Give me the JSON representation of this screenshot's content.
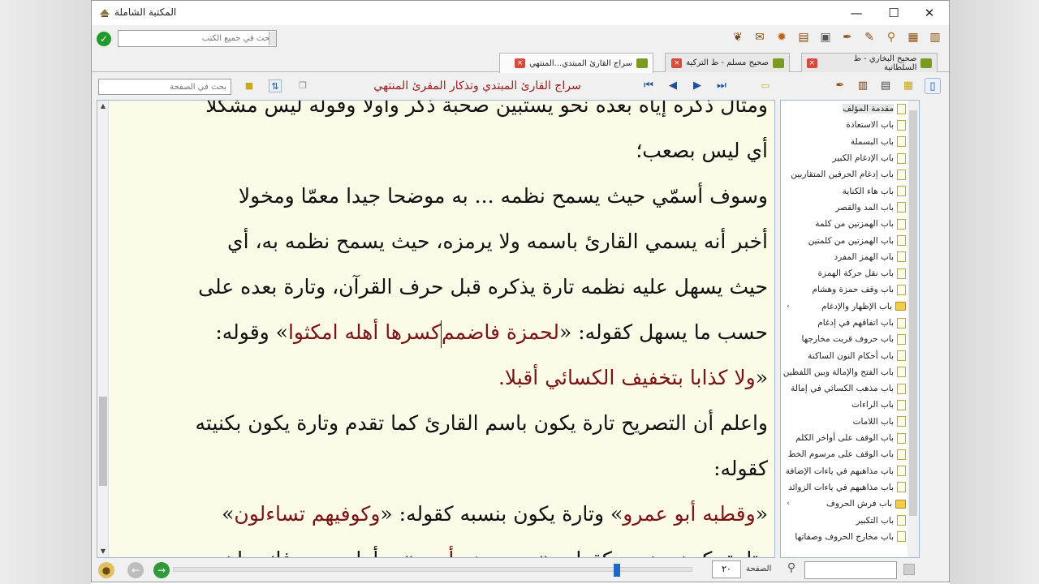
{
  "window": {
    "title": "المكتبة الشاملة",
    "controls": [
      "—",
      "☐",
      "✕"
    ]
  },
  "toolbar": {
    "global_search_placeholder": "بحث في جميع الكتب",
    "icons": [
      "book-icon",
      "bookshelf-icon",
      "search-icon",
      "edit-icon",
      "feather-icon",
      "save-icon",
      "layout-icon",
      "settings-icon",
      "mail-icon",
      "leaf-icon"
    ]
  },
  "tabs": [
    {
      "label": "صحيح البخاري - ط السلطانية",
      "active": false
    },
    {
      "label": "صحيح مسلم - ط التركية",
      "active": false
    },
    {
      "label": "سراج القارئ المبتدي...المنتهي",
      "active": true
    }
  ],
  "nav": {
    "page_search_placeholder": "بحث في الصفحة",
    "book_title": "سراج القارئ المبتدي وتذكار المقرئ المنتهي",
    "first": "⏮",
    "prev": "◀",
    "next": "▶",
    "last": "⏭"
  },
  "content": {
    "lines": [
      "ومثال ذكره إياه بعده نحو يستبين صحبة ذكر وأولا وقوله ليس مشكلا",
      "أي ليس بصعب؛",
      "وسوف أسمّي حيث يسمح نظمه ... به موضحا جيدا معمّا ومخولا",
      "أخبر أنه يسمي القارئ باسمه ولا يرمزه، حيث يسمح نظمه به، أي",
      "حيث يسهل عليه نظمه تارة يذكره قبل حرف القرآن، وتارة بعده على",
      "حسب ما يسهل كقوله: ⟪لحمزة فاضمم|كسرها أهله امكثوا⟫ وقوله:",
      "⟪ولا كذابا بتخفيف الكسائي أقبلا.",
      "واعلم أن التصريح تارة يكون باسم القارئ كما تقدم وتارة يكون بكنيته",
      "كقوله:",
      "⟪وقطبه أبو عمرو⟫ وتارة يكون بنسبه كقوله: ⟪وكوفيهم تساءلون⟫",
      "وتارة يكون بضمير كقوله: ⟪وبصروهم أدري⟫. وأما حرمي فإنه وإن"
    ]
  },
  "sidebar": {
    "items": [
      {
        "label": "مقدمة المؤلف",
        "type": "doc",
        "selected": true
      },
      {
        "label": "باب الاستعاذة",
        "type": "doc"
      },
      {
        "label": "باب البسملة",
        "type": "doc"
      },
      {
        "label": "باب الإدغام الكبير",
        "type": "doc"
      },
      {
        "label": "باب إدغام الحرفين المتقاربين",
        "type": "doc"
      },
      {
        "label": "باب هاء الكناية",
        "type": "doc"
      },
      {
        "label": "باب المد والقصر",
        "type": "doc"
      },
      {
        "label": "باب الهمزتين من كلمة",
        "type": "doc"
      },
      {
        "label": "باب الهمزتين من كلمتين",
        "type": "doc"
      },
      {
        "label": "باب الهمز المفرد",
        "type": "doc"
      },
      {
        "label": "باب نقل حركة الهمزة",
        "type": "doc"
      },
      {
        "label": "باب وقف حمزة وهشام",
        "type": "doc"
      },
      {
        "label": "باب الإظهار والإدغام",
        "type": "folder"
      },
      {
        "label": "باب اتفاقهم في إدغام",
        "type": "doc"
      },
      {
        "label": "باب حروف قربت مخارجها",
        "type": "doc"
      },
      {
        "label": "باب أحكام النون الساكنة",
        "type": "doc"
      },
      {
        "label": "باب الفتح والإمالة وبين اللفظين",
        "type": "doc"
      },
      {
        "label": "باب مذهب الكسائي في إمالة",
        "type": "doc"
      },
      {
        "label": "باب الراءات",
        "type": "doc"
      },
      {
        "label": "باب اللامات",
        "type": "doc"
      },
      {
        "label": "باب الوقف على أواخر الكلم",
        "type": "doc"
      },
      {
        "label": "باب الوقف على مرسوم الخط",
        "type": "doc"
      },
      {
        "label": "باب مذاهبهم في ياءات الإضافة",
        "type": "doc"
      },
      {
        "label": "باب مذاهبهم في ياءات الزوائد",
        "type": "doc"
      },
      {
        "label": "باب فرش الحروف",
        "type": "folder"
      },
      {
        "label": "باب التكبير",
        "type": "doc"
      },
      {
        "label": "باب مخارج الحروف وصفاتها",
        "type": "doc"
      }
    ]
  },
  "status": {
    "page_label": "الصفحة",
    "page_value": "٢٠",
    "progress_fraction": 0.86
  },
  "colors": {
    "content_bg": "#fbfbe8",
    "title_red": "#9b1c1c",
    "quote_red": "#7a1414",
    "accent_blue": "#1d67c4"
  }
}
